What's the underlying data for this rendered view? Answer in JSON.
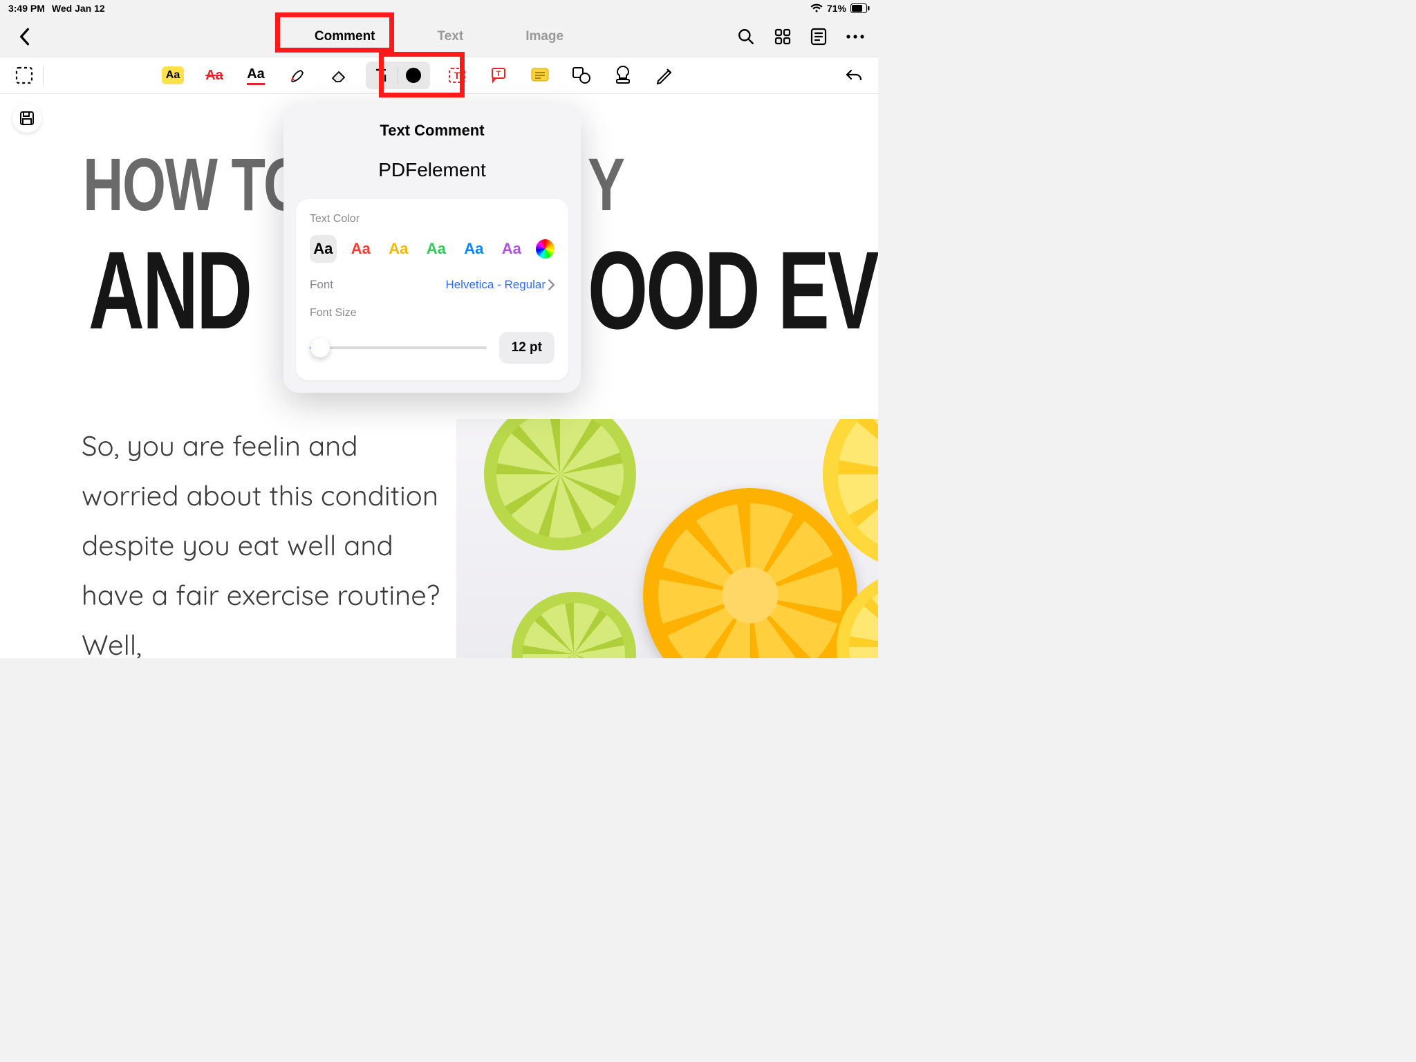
{
  "status": {
    "time": "3:49 PM",
    "date": "Wed Jan 12",
    "battery": "71%"
  },
  "tabs": {
    "comment": "Comment",
    "text": "Text",
    "image": "Image"
  },
  "popover": {
    "title": "Text Comment",
    "sample": "PDFelement",
    "text_color_label": "Text Color",
    "font_label": "Font",
    "font_value": "Helvetica - Regular",
    "font_size_label": "Font Size",
    "font_size_value": "12 pt",
    "colors": [
      {
        "label": "Aa",
        "css": "#000000"
      },
      {
        "label": "Aa",
        "css": "#ff3b30"
      },
      {
        "label": "Aa",
        "css": "#ffcc00"
      },
      {
        "label": "Aa",
        "css": "#34c759"
      },
      {
        "label": "Aa",
        "css": "#0a84ff"
      },
      {
        "label": "Aa",
        "css": "#af52de"
      }
    ]
  },
  "document": {
    "title_line1_a": "HOW TO",
    "title_line1_b": "Y",
    "title_line2_a": "AND",
    "title_line2_b": "OOD EV",
    "body": "So, you are feelin and worried about this condition despite you eat well and have a fair exercise routine? Well,"
  }
}
